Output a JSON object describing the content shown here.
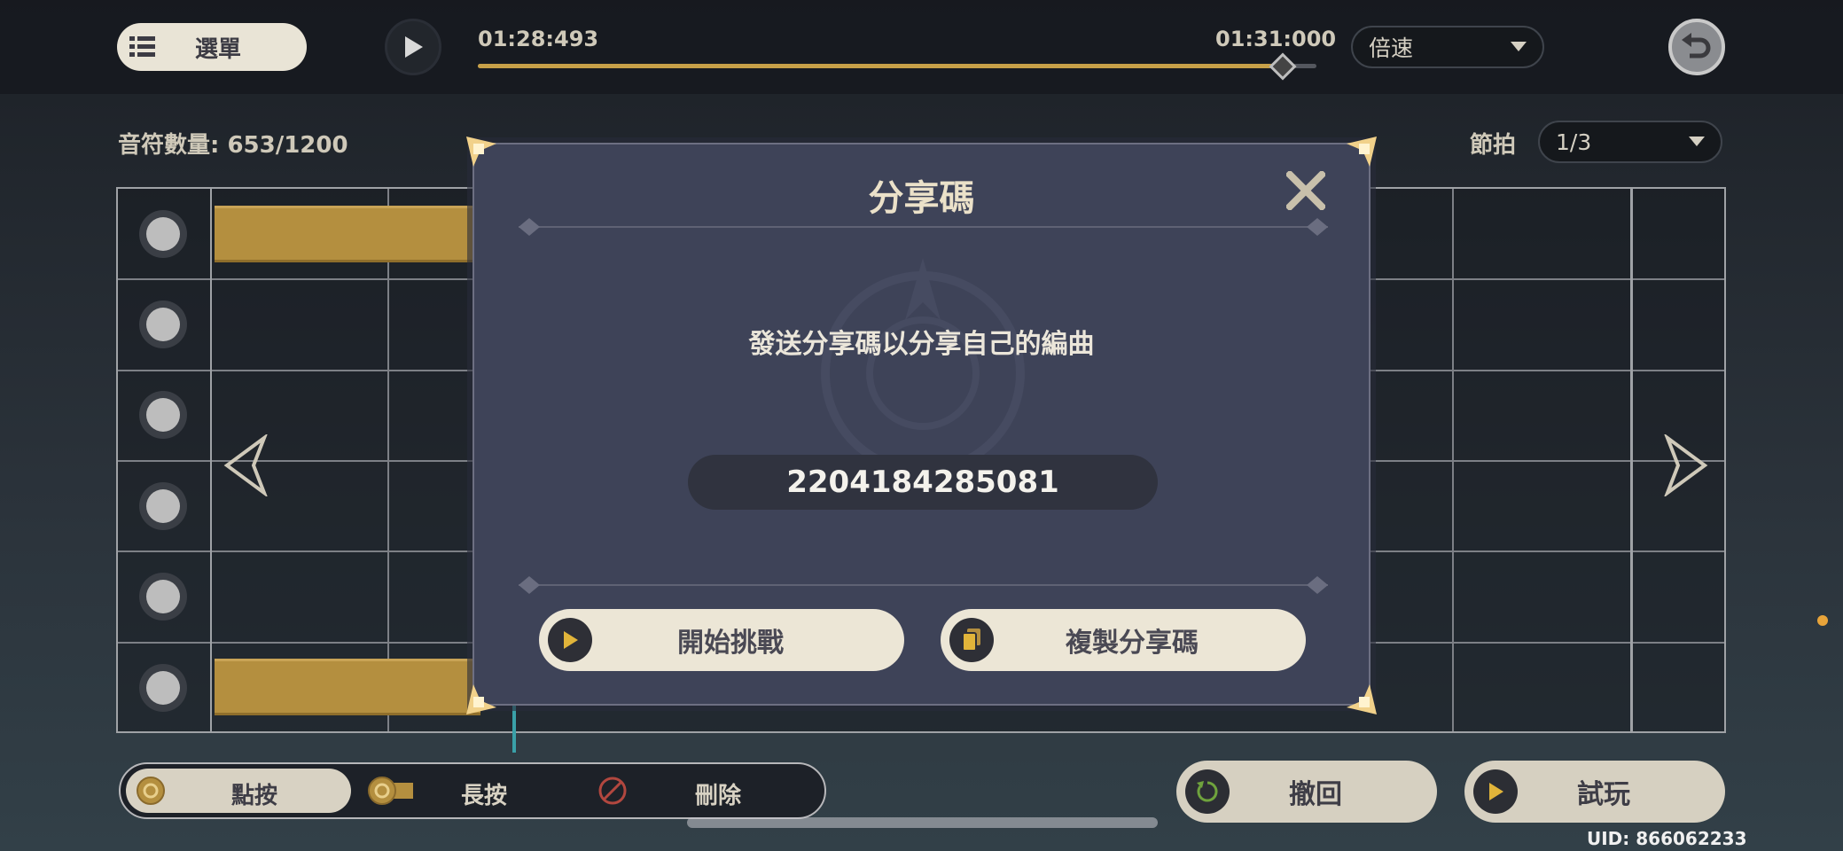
{
  "toolbar": {
    "menu_label": "選單",
    "current_time": "01:28:493",
    "total_time": "01:31:000",
    "progress": 0.96,
    "speed_label": "倍速"
  },
  "info": {
    "note_count": "音符數量: 653/1200",
    "beat_label": "節拍",
    "beat_value": "1/3"
  },
  "modal": {
    "title": "分享碼",
    "description": "發送分享碼以分享自己的編曲",
    "share_code": "2204184285081",
    "start_challenge_label": "開始挑戰",
    "copy_code_label": "複製分享碼"
  },
  "modes": {
    "tap_label": "點按",
    "hold_label": "長按",
    "delete_label": "刪除",
    "active": "tap"
  },
  "actions": {
    "undo_label": "撤回",
    "try_label": "試玩"
  },
  "footer": {
    "uid": "UID: 866062233"
  },
  "colors": {
    "accent_gold": "#c7a048",
    "modal_bg": "#3e4358",
    "button_cream": "#ece6d6"
  }
}
